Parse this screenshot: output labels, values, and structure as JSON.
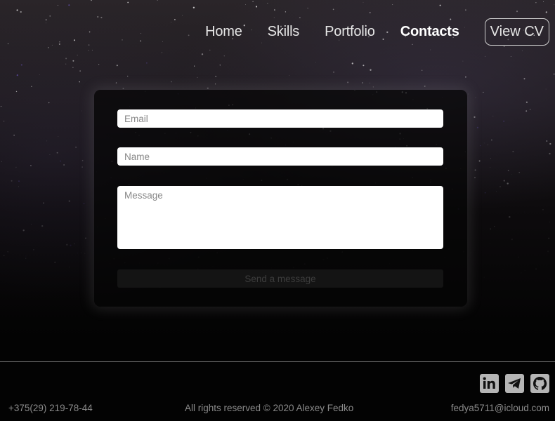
{
  "nav": {
    "items": [
      {
        "label": "Home",
        "active": false
      },
      {
        "label": "Skills",
        "active": false
      },
      {
        "label": "Portfolio",
        "active": false
      },
      {
        "label": "Contacts",
        "active": true
      }
    ],
    "cv_label": "View CV"
  },
  "form": {
    "email_placeholder": "Email",
    "name_placeholder": "Name",
    "message_placeholder": "Message",
    "send_label": "Send a message"
  },
  "footer": {
    "phone": "+375(29) 219-78-44",
    "copyright": "All rights reserved © 2020 Alexey Fedko",
    "email": "fedya5711@icloud.com",
    "social": [
      "linkedin-icon",
      "telegram-icon",
      "github-icon"
    ]
  },
  "colors": {
    "background": "#030303",
    "nav_text": "#e6e6e6",
    "footer_text": "#8a8a8a",
    "icon_bg": "#b5b5b5"
  }
}
